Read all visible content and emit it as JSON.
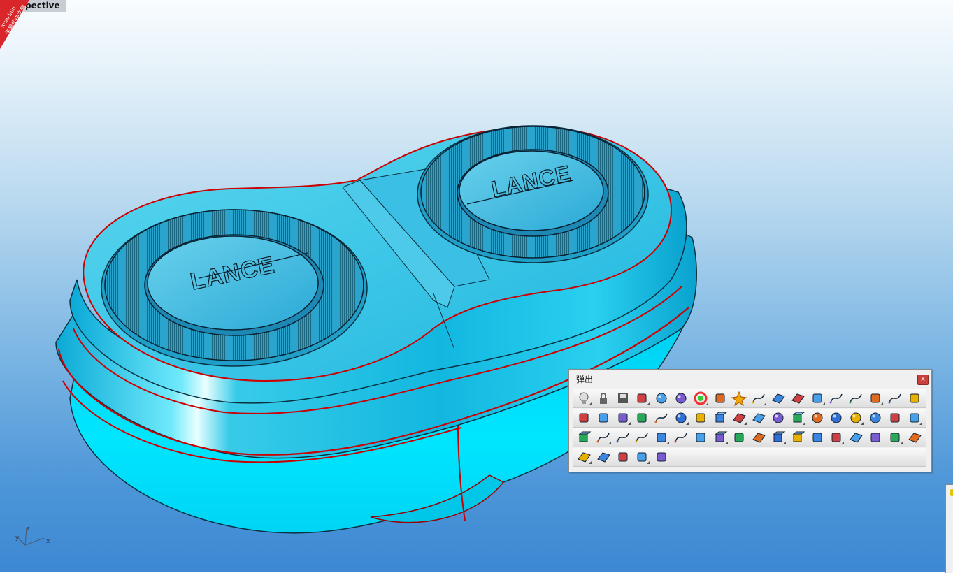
{
  "viewport": {
    "label": "Perspective",
    "background_top": "#f9fcfe",
    "background_bottom": "#3d88d3"
  },
  "model": {
    "logo_text_left": "LANCE",
    "logo_text_right": "LANCE",
    "body_color": "#00e6ff",
    "top_color": "#27c7e6",
    "edge_color": "#cc0000"
  },
  "axes": {
    "x": "x",
    "y": "y",
    "z": "z"
  },
  "watermark": {
    "line1": "xuexiniu",
    "line2": "学犀牛中文网"
  },
  "popup": {
    "title": "弹出",
    "close_label": "x",
    "rows": [
      [
        "lightbulb-icon",
        "lock-icon",
        "save-icon",
        "zoom-extents-icon",
        "wireframe-sphere-icon",
        "shaded-sphere-icon",
        "color-wheel-icon",
        "options-gear-icon",
        "render-icon",
        "arc-curve-icon",
        "surface-patch-icon",
        "sweep-surface-icon",
        "explode-icon",
        "blend-curve-icon",
        "blend-surface-icon",
        "point-cloud-icon",
        "arch-icon",
        "rotate-3d-icon"
      ],
      [
        "mirror-icon",
        "grid-points-icon",
        "align-icon",
        "extrude-icon",
        "polyline-icon",
        "circle-icon",
        "layers-icon",
        "cylinder-icon",
        "plane-icon",
        "surface-icon",
        "circle-sphere-icon",
        "box-icon",
        "sphere-icon",
        "boolean-union-icon",
        "boolean-intersect-icon",
        "boolean-difference-icon",
        "offset-icon",
        "pipe-icon"
      ],
      [
        "solid-box-icon",
        "fillet-curve-icon",
        "curve-icon",
        "arc-blend-icon",
        "walk-icon",
        "polyline-2-icon",
        "list-icon",
        "cylinder-solid-icon",
        "array-icon",
        "sweep-icon",
        "cylinder-2-icon",
        "cylinder-3-icon",
        "pie-icon",
        "pie-2-icon",
        "surface-2-icon",
        "funnel-icon",
        "cone-icon",
        "patch-icon"
      ],
      [
        "loft-icon",
        "plane-2-icon",
        "flip-icon",
        "rotate-icon",
        "clipping-icon"
      ]
    ]
  }
}
